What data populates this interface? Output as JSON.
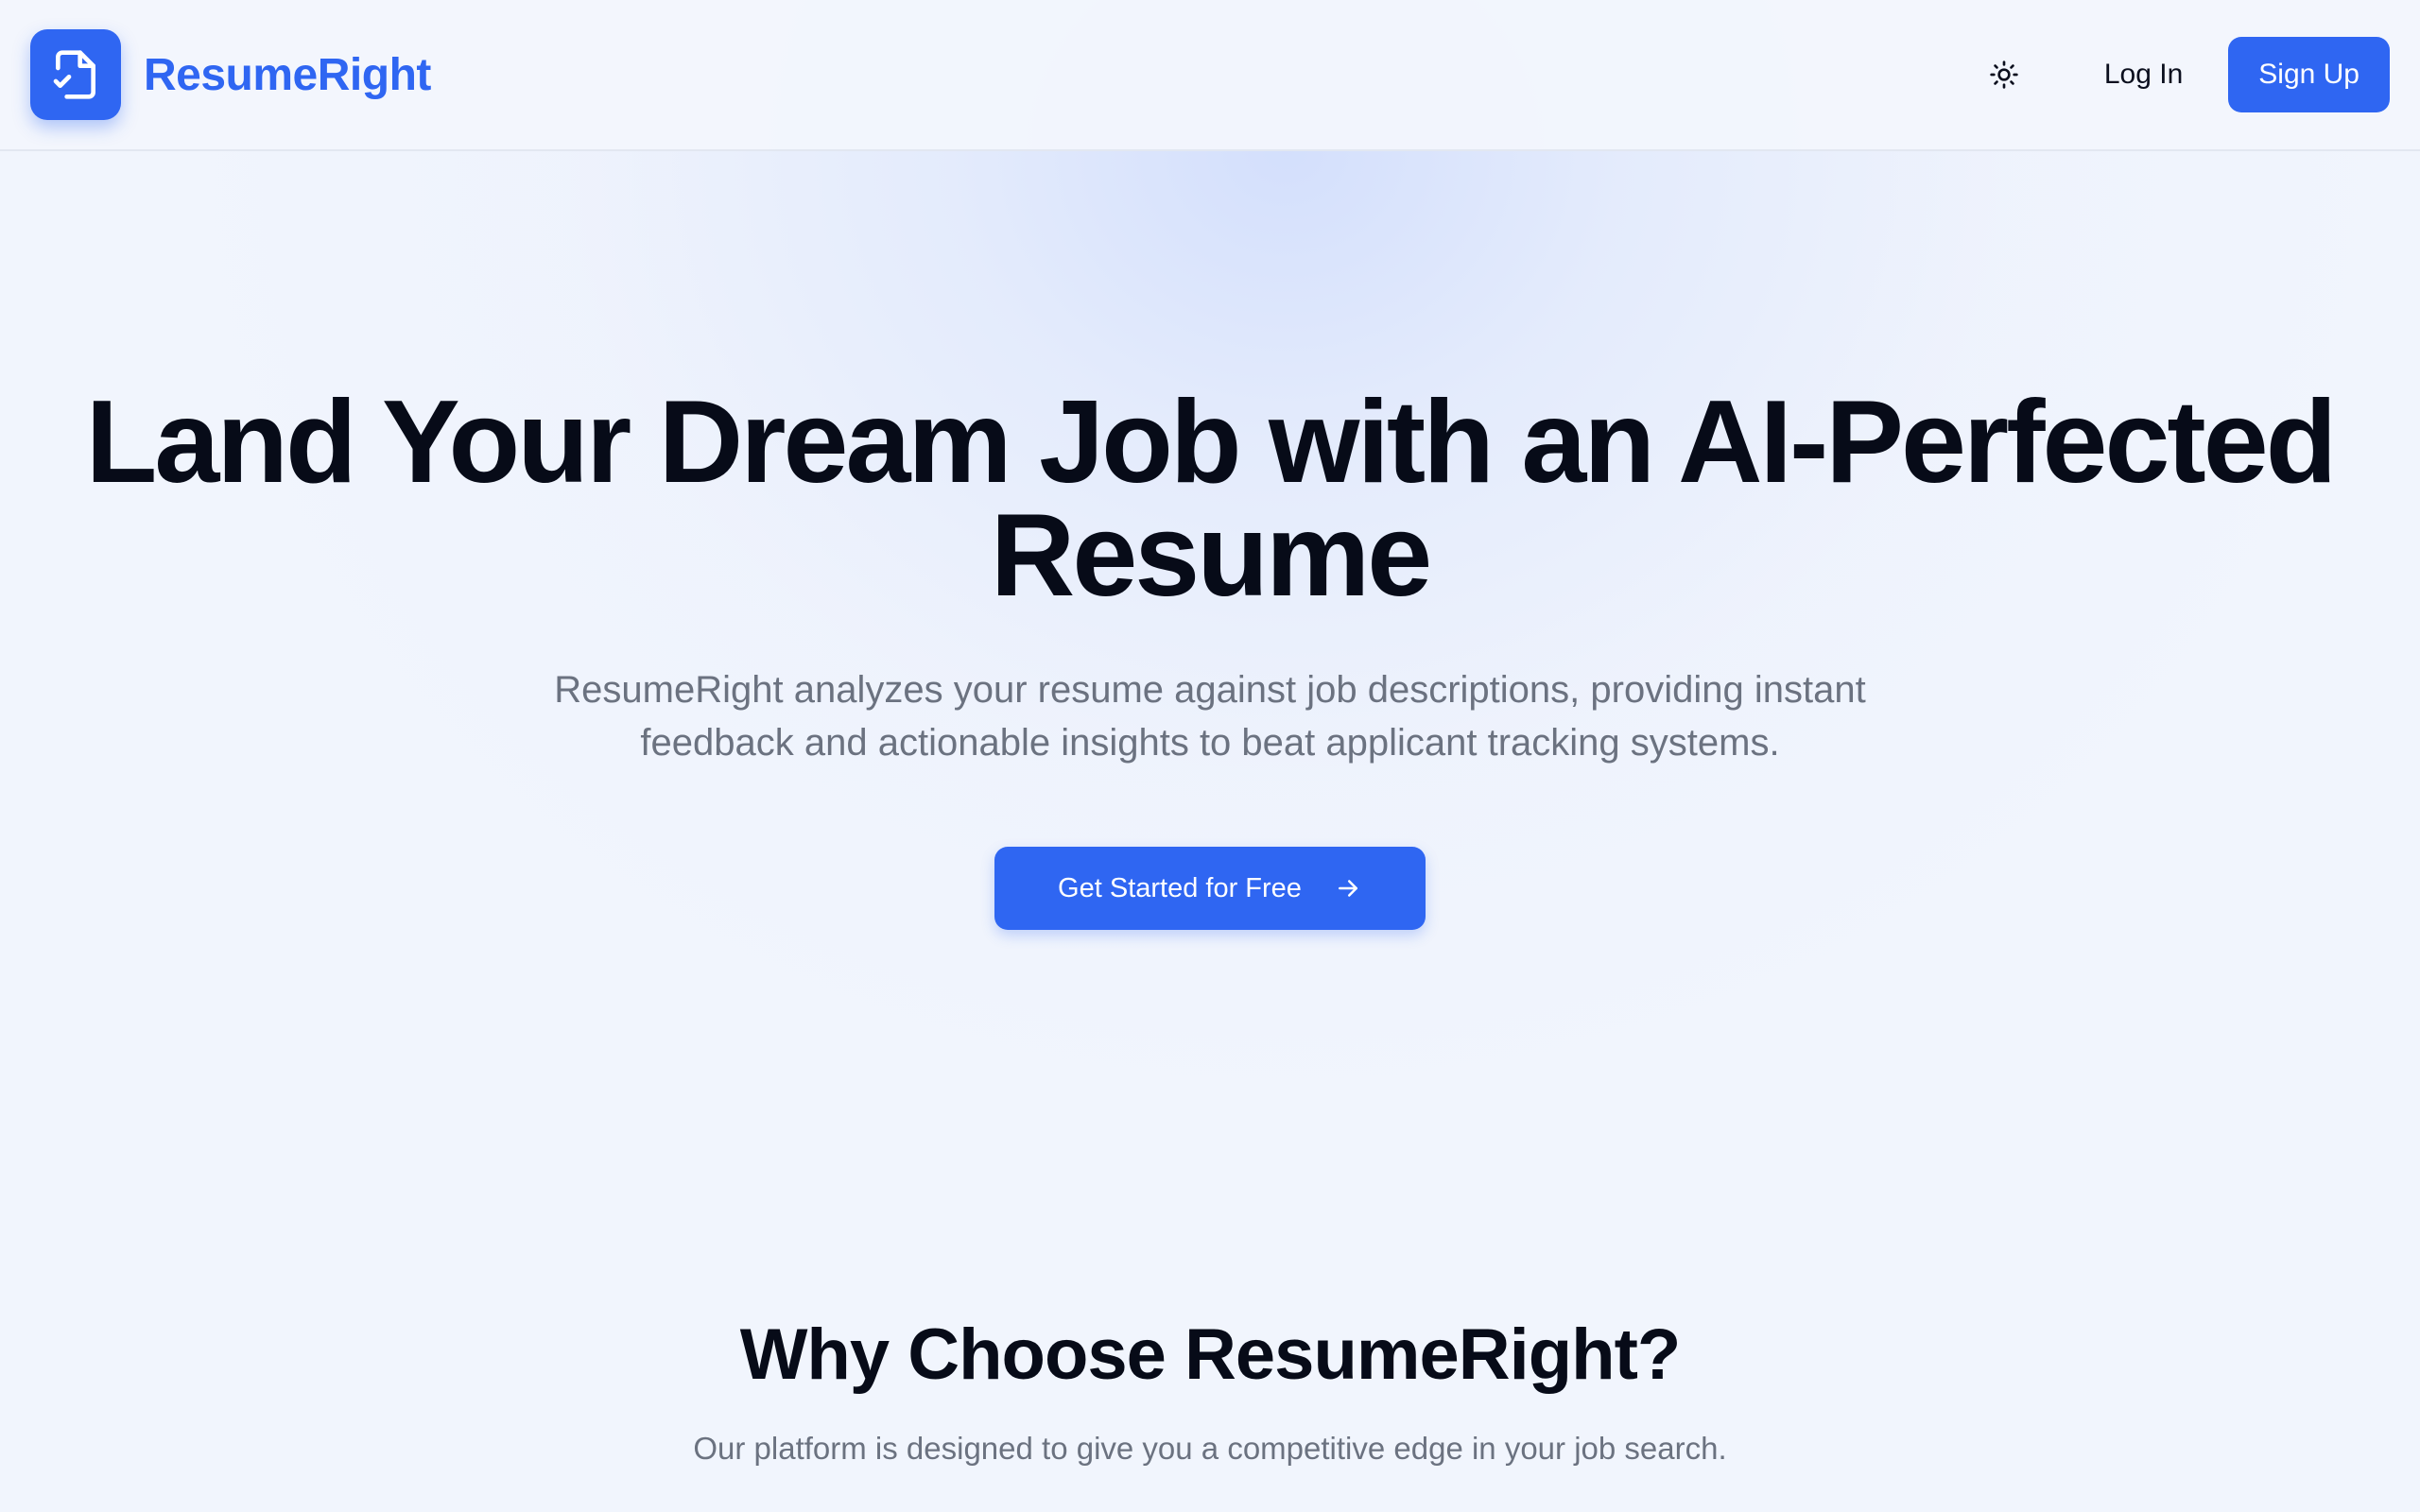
{
  "header": {
    "brand_name": "ResumeRight",
    "logo_icon": "document-check-icon",
    "theme_toggle_icon": "sun-icon",
    "login_label": "Log In",
    "signup_label": "Sign Up"
  },
  "hero": {
    "title_line1": "Land Your Dream Job with an AI-Perfected",
    "title_line2": "Resume",
    "subtitle_line1": "ResumeRight analyzes your resume against job descriptions, providing instant",
    "subtitle_line2": "feedback and actionable insights to beat applicant tracking systems.",
    "cta_label": "Get Started for Free",
    "cta_icon": "arrow-right-icon"
  },
  "features": {
    "title": "Why Choose ResumeRight?",
    "subtitle": "Our platform is designed to give you a competitive edge in your job search."
  },
  "colors": {
    "accent": "#2f66f2",
    "background": "#f1f5fd",
    "heading": "#070b18",
    "muted_text": "#6b7280"
  }
}
